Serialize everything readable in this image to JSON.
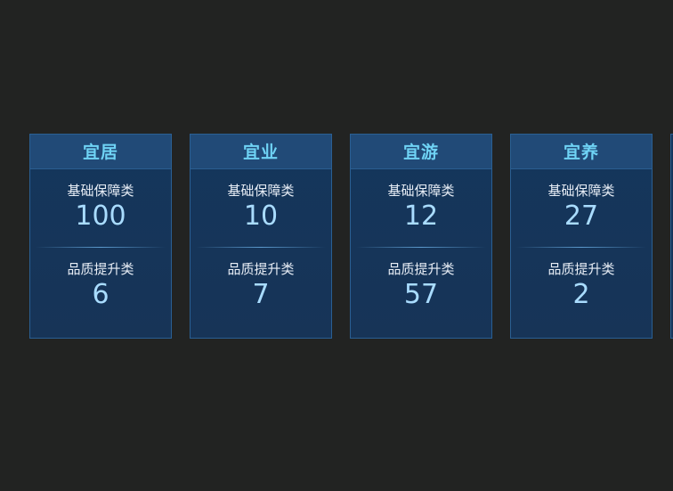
{
  "cards": [
    {
      "title": "宜居",
      "basic_label": "基础保障类",
      "basic_value": "100",
      "quality_label": "品质提升类",
      "quality_value": "6"
    },
    {
      "title": "宜业",
      "basic_label": "基础保障类",
      "basic_value": "10",
      "quality_label": "品质提升类",
      "quality_value": "7"
    },
    {
      "title": "宜游",
      "basic_label": "基础保障类",
      "basic_value": "12",
      "quality_label": "品质提升类",
      "quality_value": "57"
    },
    {
      "title": "宜养",
      "basic_label": "基础保障类",
      "basic_value": "27",
      "quality_label": "品质提升类",
      "quality_value": "2"
    }
  ],
  "colors": {
    "background": "#222322",
    "card_fill": "#14365c",
    "card_border": "#2a5f93",
    "title_bar": "#214a77",
    "title_text": "#6fd3f5",
    "value_text": "#a9dcff"
  }
}
